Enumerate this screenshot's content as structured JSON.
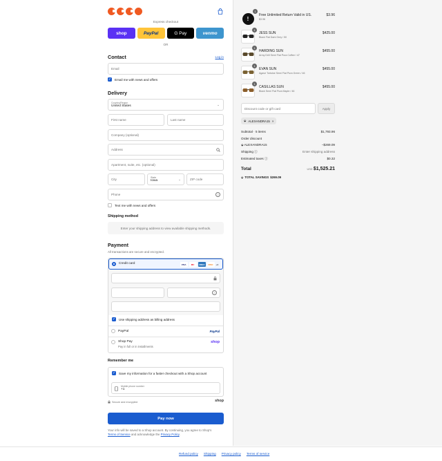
{
  "express": {
    "label": "Express checkout",
    "or": "OR"
  },
  "wallets": {
    "shop": "shop",
    "paypal": "PayPal",
    "gpay": "G Pay",
    "venmo": "venmo"
  },
  "contact": {
    "title": "Contact",
    "login": "Log in",
    "email_placeholder": "Email",
    "news_label": "Email me with news and offers",
    "news_checked": true
  },
  "delivery": {
    "title": "Delivery",
    "country_label": "Country/Region",
    "country_value": "United States",
    "first_name": "First name",
    "last_name": "Last name",
    "company": "Company (optional)",
    "address": "Address",
    "apartment": "Apartment, suite, etc. (optional)",
    "city": "City",
    "state_label": "State",
    "state_value": "Iowa",
    "zip": "ZIP code",
    "phone": "Phone",
    "text_label": "Text me with news and offers",
    "text_checked": false
  },
  "shipping": {
    "title": "Shipping method",
    "note": "Enter your shipping address to view available shipping methods."
  },
  "payment": {
    "title": "Payment",
    "subtitle": "All transactions are secure and encrypted.",
    "credit_card": "Credit card",
    "more_cards": "+4",
    "card_icons": [
      "VISA",
      "MC",
      "AMEX",
      "DISC"
    ],
    "billing_same": "Use shipping address as billing address",
    "paypal": "PayPal",
    "paypal_logo": "PayPal",
    "shop_pay": "Shop Pay",
    "shop_pay_sub": "Pay in full or in installments",
    "shop_logo": "shop"
  },
  "remember": {
    "title": "Remember me",
    "save_label": "Save my information for a faster checkout with a Shop account",
    "mobile_label": "Mobile phone number",
    "mobile_prefix": "+1",
    "secure": "Secure and encrypted",
    "shop_logo": "shop"
  },
  "pay_now": "Pay now",
  "legal": {
    "text1": "Your info will be saved to a Shop account. By continuing, you agree to Shop's",
    "tos": "Terms of Service",
    "mid": "and acknowledge the",
    "privacy": "Privacy Policy",
    "end": "."
  },
  "footer": [
    "Refund policy",
    "Shipping",
    "Privacy policy",
    "Terms of service"
  ],
  "items": [
    {
      "name": "Free Unlimited Return Valid in US.",
      "sub": "$3.96",
      "price": "$3.96",
      "qty": "1"
    },
    {
      "name": "JESS SUN",
      "sub": "Black Flat Dark Grey / 50",
      "price": "$425.00",
      "qty": "1"
    },
    {
      "name": "HARDING SUN",
      "sub": "Army Drill Semi Flat Pura Coffee / 47",
      "price": "$455.00",
      "qty": "1"
    },
    {
      "name": "EVAN SUN",
      "sub": "Agave Tortoise Semi Flat Pura Green / 46",
      "price": "$455.00",
      "qty": "1"
    },
    {
      "name": "CASILLAS SUN",
      "sub": "Black Semi Flat Pura Maple / 46",
      "price": "$455.00",
      "qty": "1"
    }
  ],
  "discount": {
    "placeholder": "Discount code or gift card",
    "apply": "Apply",
    "code": "ALEXANDRA15"
  },
  "summary": {
    "subtotal_label": "Subtotal · 5 items",
    "subtotal": "$1,793.96",
    "order_discount": "Order discount",
    "discount_code": "ALEXANDRA15",
    "discount_value": "−$269.09",
    "shipping_label": "Shipping",
    "shipping_value": "Enter shipping address",
    "taxes_label": "Estimated taxes",
    "taxes_value": "$0.32",
    "total_label": "Total",
    "currency": "USD",
    "total": "$1,525.21",
    "savings_label": "TOTAL SAVINGS",
    "savings": "$269.09"
  },
  "colors": {
    "accent": "#1a5ccf",
    "brand": "#f05a22",
    "shop": "#5a31f4"
  }
}
